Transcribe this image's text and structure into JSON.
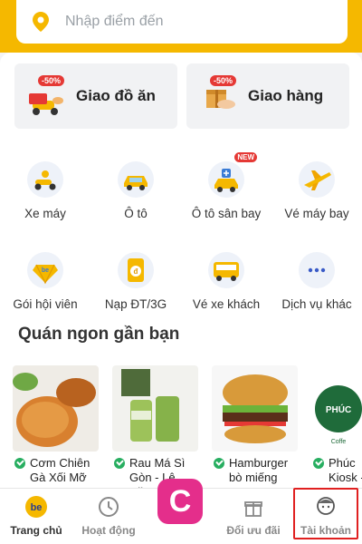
{
  "search": {
    "placeholder": "Nhập điểm đến"
  },
  "services": [
    {
      "label": "Giao đồ ăn",
      "badge": "-50%",
      "icon": "food-delivery-icon"
    },
    {
      "label": "Giao hàng",
      "badge": "-50%",
      "icon": "package-delivery-icon"
    }
  ],
  "grid": [
    {
      "label": "Xe máy",
      "icon": "motorbike-icon"
    },
    {
      "label": "Ô tô",
      "icon": "car-icon"
    },
    {
      "label": "Ô tô sân bay",
      "icon": "airport-car-icon",
      "badge": "NEW"
    },
    {
      "label": "Vé máy bay",
      "icon": "airplane-icon"
    },
    {
      "label": "Gói hội viên",
      "icon": "membership-icon"
    },
    {
      "label": "Nạp ĐT/3G",
      "icon": "topup-icon"
    },
    {
      "label": "Vé xe khách",
      "icon": "bus-icon"
    },
    {
      "label": "Dịch vụ khác",
      "icon": "more-icon"
    }
  ],
  "section_title": "Quán ngon gần bạn",
  "foods": [
    {
      "line1": "Cơm Chiên",
      "line2": "Gà Xối Mỡ Hư..."
    },
    {
      "line1": "Rau Má Sì",
      "line2": "Gòn - Lê Văn..."
    },
    {
      "line1": "Hamburger",
      "line2": "bò miếng HA..."
    },
    {
      "line1": "Phúc",
      "line2": "Kiosk -",
      "brand": "PHÚC",
      "brand_sub": "Coffe"
    }
  ],
  "nav": [
    {
      "label": "Trang chủ",
      "icon": "be-home-icon",
      "active": true,
      "icon_text": "be"
    },
    {
      "label": "Hoạt động",
      "icon": "clock-icon",
      "active": false
    },
    {
      "label": "",
      "icon": "center-app-icon",
      "active": false,
      "icon_text": "C"
    },
    {
      "label": "Đổi ưu đãi",
      "icon": "gift-icon",
      "active": false
    },
    {
      "label": "Tài khoản",
      "icon": "account-icon",
      "active": false
    }
  ],
  "colors": {
    "brand_yellow": "#f5b800",
    "badge_red": "#e53935",
    "highlight_red": "#e02020",
    "center_pink": "#e42e8b"
  }
}
